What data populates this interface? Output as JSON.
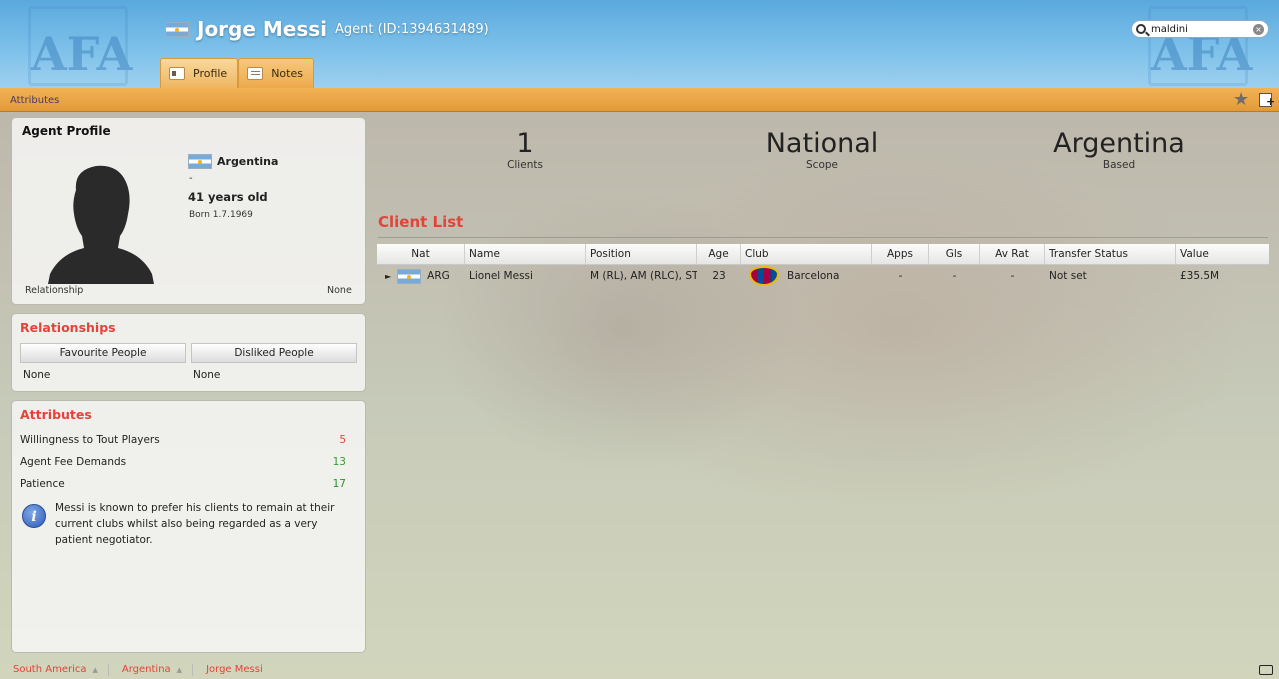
{
  "header": {
    "name": "Jorge Messi",
    "subtitle": "Agent (ID:1394631489)",
    "crest_text": "AFA",
    "tabs": [
      {
        "label": "Profile",
        "icon": "profile-card-icon",
        "active": true
      },
      {
        "label": "Notes",
        "icon": "notes-icon",
        "active": false
      }
    ],
    "search": {
      "value": "maldini"
    }
  },
  "subbar": {
    "link": "Attributes"
  },
  "profile": {
    "title": "Agent Profile",
    "nationality": "Argentina",
    "dash": "-",
    "age": "41 years old",
    "born": "Born 1.7.1969",
    "relationship_label": "Relationship",
    "relationship_value": "None"
  },
  "relationships": {
    "title": "Relationships",
    "favourite_label": "Favourite People",
    "disliked_label": "Disliked People",
    "favourite_value": "None",
    "disliked_value": "None"
  },
  "attributes": {
    "title": "Attributes",
    "items": [
      {
        "name": "Willingness to Tout Players",
        "value": "5",
        "color": "#e2443a"
      },
      {
        "name": "Agent Fee Demands",
        "value": "13",
        "color": "#3a9a3a"
      },
      {
        "name": "Patience",
        "value": "17",
        "color": "#2f8a2f"
      }
    ],
    "info": "Messi is known to prefer his clients to remain at their current clubs whilst also being regarded as a very patient negotiator."
  },
  "stats": [
    {
      "value": "1",
      "label": "Clients"
    },
    {
      "value": "National",
      "label": "Scope"
    },
    {
      "value": "Argentina",
      "label": "Based"
    }
  ],
  "client_list": {
    "title": "Client List",
    "columns": [
      "Nat",
      "Name",
      "Position",
      "Age",
      "Club",
      "Apps",
      "Gls",
      "Av Rat",
      "Transfer Status",
      "Value"
    ],
    "rows": [
      {
        "nat": "ARG",
        "name": "Lionel Messi",
        "position": "M (RL), AM (RLC), ST",
        "age": "23",
        "club": "Barcelona",
        "apps": "-",
        "gls": "-",
        "avrat": "-",
        "status": "Not set",
        "value": "£35.5M"
      }
    ]
  },
  "footer": {
    "crumbs": [
      "South America",
      "Argentina",
      "Jorge Messi"
    ]
  },
  "colors": {
    "accent_red": "#e2443a",
    "bar_orange": "#e8a040",
    "header_blue": "#6cb6e4"
  }
}
